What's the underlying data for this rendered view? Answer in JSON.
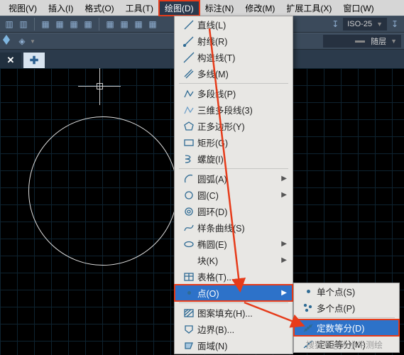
{
  "menubar": [
    "视图(V)",
    "插入(I)",
    "格式(O)",
    "工具(T)",
    "绘图(D)",
    "标注(N)",
    "修改(M)",
    "扩展工具(X)",
    "窗口(W)"
  ],
  "menubar_active_index": 4,
  "combo": {
    "iso": "ISO-25",
    "layer": "随层"
  },
  "drawmenu": [
    {
      "icon": "line-icon",
      "label": "直线(L)"
    },
    {
      "icon": "ray-icon",
      "label": "射线(R)"
    },
    {
      "icon": "xline-icon",
      "label": "构造线(T)"
    },
    {
      "icon": "mline-icon",
      "label": "多线(M)"
    },
    {
      "divider": true
    },
    {
      "icon": "pline-icon",
      "label": "多段线(P)"
    },
    {
      "icon": "pline3d-icon",
      "label": "三维多段线(3)"
    },
    {
      "icon": "polygon-icon",
      "label": "正多边形(Y)"
    },
    {
      "icon": "rect-icon",
      "label": "矩形(G)"
    },
    {
      "icon": "helix-icon",
      "label": "螺旋(I)"
    },
    {
      "divider": true
    },
    {
      "icon": "arc-icon",
      "label": "圆弧(A)",
      "sub": true
    },
    {
      "icon": "circle-icon",
      "label": "圆(C)",
      "sub": true
    },
    {
      "icon": "donut-icon",
      "label": "圆环(D)"
    },
    {
      "icon": "spline-icon",
      "label": "样条曲线(S)"
    },
    {
      "icon": "ellipse-icon",
      "label": "椭圆(E)",
      "sub": true
    },
    {
      "icon": "block-icon",
      "label": "块(K)",
      "sub": true
    },
    {
      "icon": "table-icon",
      "label": "表格(T)..."
    },
    {
      "icon": "point-icon",
      "label": "点(O)",
      "sub": true,
      "hl": true
    },
    {
      "divider": true
    },
    {
      "icon": "hatch-icon",
      "label": "图案填充(H)..."
    },
    {
      "icon": "boundary-icon",
      "label": "边界(B)..."
    },
    {
      "icon": "region-icon",
      "label": "面域(N)"
    }
  ],
  "pointmenu": [
    {
      "icon": "pt-single-icon",
      "label": "单个点(S)"
    },
    {
      "icon": "pt-multi-icon",
      "label": "多个点(P)"
    },
    {
      "divider": true
    },
    {
      "icon": "pt-divide-icon",
      "label": "定数等分(D)",
      "hl": true
    },
    {
      "icon": "pt-measure-icon",
      "label": "定距等分(M)"
    }
  ],
  "watermark": "搜狐号@大水牛测绘"
}
